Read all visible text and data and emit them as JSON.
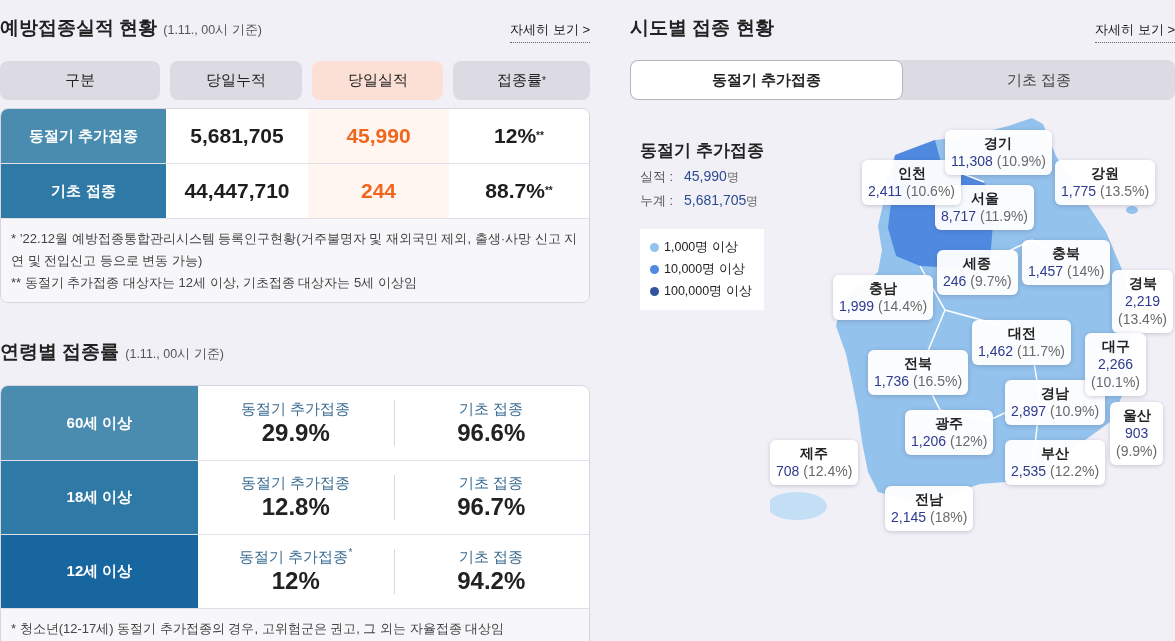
{
  "rates": {
    "title": "예방접종실적 현황",
    "basis": "(1.11., 00시 기준)",
    "more_link": "자세히 보기 >",
    "columns": [
      {
        "label": "구분",
        "kind": "plain"
      },
      {
        "label": "당일누적",
        "kind": "plain"
      },
      {
        "label": "당일실적",
        "kind": "highlight"
      },
      {
        "label": "접종률",
        "mark": "*",
        "kind": "plain"
      }
    ],
    "rows": [
      {
        "label": "동절기 추가접종",
        "cumulative": "5,681,705",
        "daily": "45,990",
        "rate": "12%",
        "rate_mark": "**"
      },
      {
        "label": "기초 접종",
        "cumulative": "44,447,710",
        "daily": "244",
        "rate": "88.7%",
        "rate_mark": "**"
      }
    ],
    "footnotes": [
      "* ’22.12월 예방접종통합관리시스템 등록인구현황(거주불명자 및 재외국민 제외, 출생·사망 신고 지연 및 전입신고 등으로 변동 가능)",
      "** 동절기 추가접종 대상자는 12세 이상, 기초접종 대상자는 5세 이상임"
    ]
  },
  "age_rates": {
    "title": "연령별 접종률",
    "basis": "(1.11., 00시 기준)",
    "rows": [
      {
        "label": "60세 이상",
        "stats": [
          {
            "label": "동절기 추가접종",
            "value": "29.9%"
          },
          {
            "label": "기초 접종",
            "value": "96.6%"
          }
        ]
      },
      {
        "label": "18세 이상",
        "stats": [
          {
            "label": "동절기 추가접종",
            "value": "12.8%"
          },
          {
            "label": "기초 접종",
            "value": "96.7%"
          }
        ]
      },
      {
        "label": "12세 이상",
        "stats": [
          {
            "label": "동절기 추가접종",
            "mark": "*",
            "value": "12%"
          },
          {
            "label": "기초 접종",
            "value": "94.2%"
          }
        ]
      }
    ],
    "footnote": "* 청소년(12-17세) 동절기 추가접종의 경우, 고위험군은 권고, 그 외는 자율접종 대상임"
  },
  "regional": {
    "title": "시도별 접종 현황",
    "more_link": "자세히 보기 >",
    "tabs": [
      {
        "label": "동절기 추가접종",
        "selected": true
      },
      {
        "label": "기초 접종",
        "selected": false
      }
    ],
    "summary": {
      "title": "동절기 추가접종",
      "lines": [
        {
          "label": "실적 :",
          "value": "45,990",
          "unit": "명"
        },
        {
          "label": "누계 :",
          "value": "5,681,705",
          "unit": "명"
        }
      ]
    },
    "legend": [
      {
        "label": "1,000명 이상",
        "color": "#93c2ec"
      },
      {
        "label": "10,000명 이상",
        "color": "#4f8ae0"
      },
      {
        "label": "100,000명 이상",
        "color": "#34539f"
      }
    ],
    "regions": [
      {
        "name": "인천",
        "count": "2,411",
        "rate": "(10.6%)"
      },
      {
        "name": "경기",
        "count": "11,308",
        "rate": "(10.9%)"
      },
      {
        "name": "서울",
        "count": "8,717",
        "rate": "(11.9%)"
      },
      {
        "name": "강원",
        "count": "1,775",
        "rate": "(13.5%)"
      },
      {
        "name": "충남",
        "count": "1,999",
        "rate": "(14.4%)"
      },
      {
        "name": "세종",
        "count": "246",
        "rate": "(9.7%)"
      },
      {
        "name": "충북",
        "count": "1,457",
        "rate": "(14%)"
      },
      {
        "name": "전북",
        "count": "1,736",
        "rate": "(16.5%)"
      },
      {
        "name": "대전",
        "count": "1,462",
        "rate": "(11.7%)"
      },
      {
        "name": "경북",
        "count": "2,219",
        "rate": "(13.4%)"
      },
      {
        "name": "제주",
        "count": "708",
        "rate": "(12.4%)"
      },
      {
        "name": "광주",
        "count": "1,206",
        "rate": "(12%)"
      },
      {
        "name": "경남",
        "count": "2,897",
        "rate": "(10.9%)"
      },
      {
        "name": "대구",
        "count": "2,266",
        "rate": "(10.1%)"
      },
      {
        "name": "부산",
        "count": "2,535",
        "rate": "(12.2%)"
      },
      {
        "name": "울산",
        "count": "903",
        "rate": "(9.9%)"
      },
      {
        "name": "전남",
        "count": "2,145",
        "rate": "(18%)"
      }
    ]
  }
}
